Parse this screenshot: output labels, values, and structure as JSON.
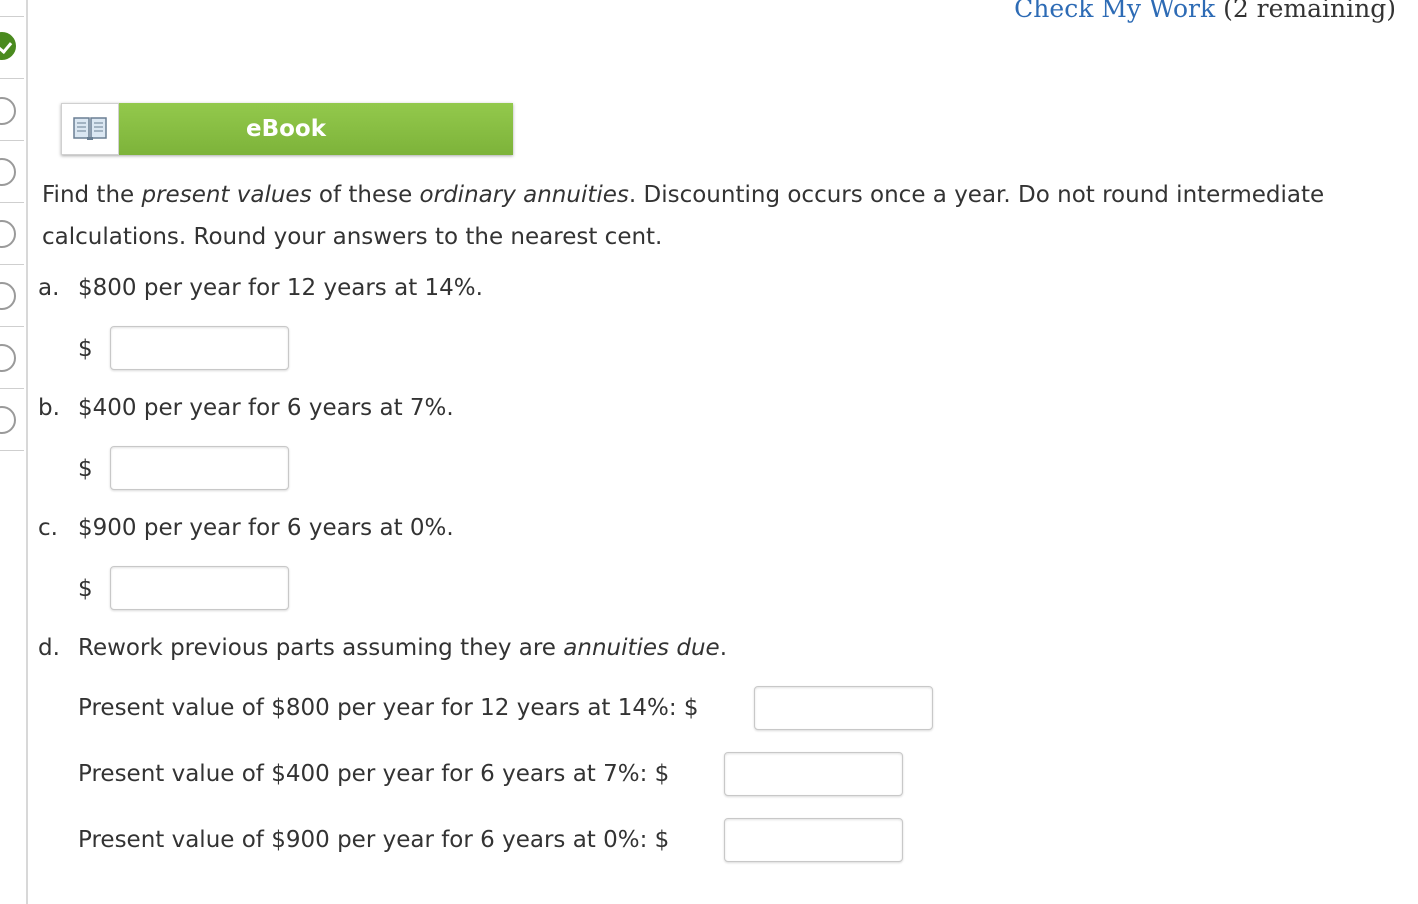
{
  "header": {
    "check_link": "Check My Work",
    "remaining": "(2 remaining)"
  },
  "nav": {
    "status": [
      "complete",
      "incomplete",
      "incomplete",
      "incomplete",
      "incomplete",
      "incomplete",
      "incomplete"
    ]
  },
  "ebook": {
    "label": "eBook",
    "icon": "book-icon"
  },
  "instructions": {
    "t1": "Find the ",
    "em1": "present values",
    "t2": " of these ",
    "em2": "ordinary annuities",
    "t3": ". Discounting occurs once a year. Do not round intermediate calculations. Round your answers to the nearest cent."
  },
  "parts": {
    "a": {
      "letter": "a.",
      "text": "$800 per year for 12 years at 14%.",
      "currency": "$",
      "value": ""
    },
    "b": {
      "letter": "b.",
      "text": "$400 per year for 6 years at 7%.",
      "currency": "$",
      "value": ""
    },
    "c": {
      "letter": "c.",
      "text": "$900 per year for 6 years at 0%.",
      "currency": "$",
      "value": ""
    },
    "d": {
      "letter": "d.",
      "text_pre": "Rework previous parts assuming they are ",
      "text_em": "annuities due",
      "text_post": ".",
      "rows": [
        {
          "label": "Present value of $800 per year for 12 years at 14%: $",
          "value": ""
        },
        {
          "label": "Present value of $400 per year for 6 years at 7%: $",
          "value": ""
        },
        {
          "label": "Present value of $900 per year for 6 years at 0%: $",
          "value": ""
        }
      ]
    }
  }
}
